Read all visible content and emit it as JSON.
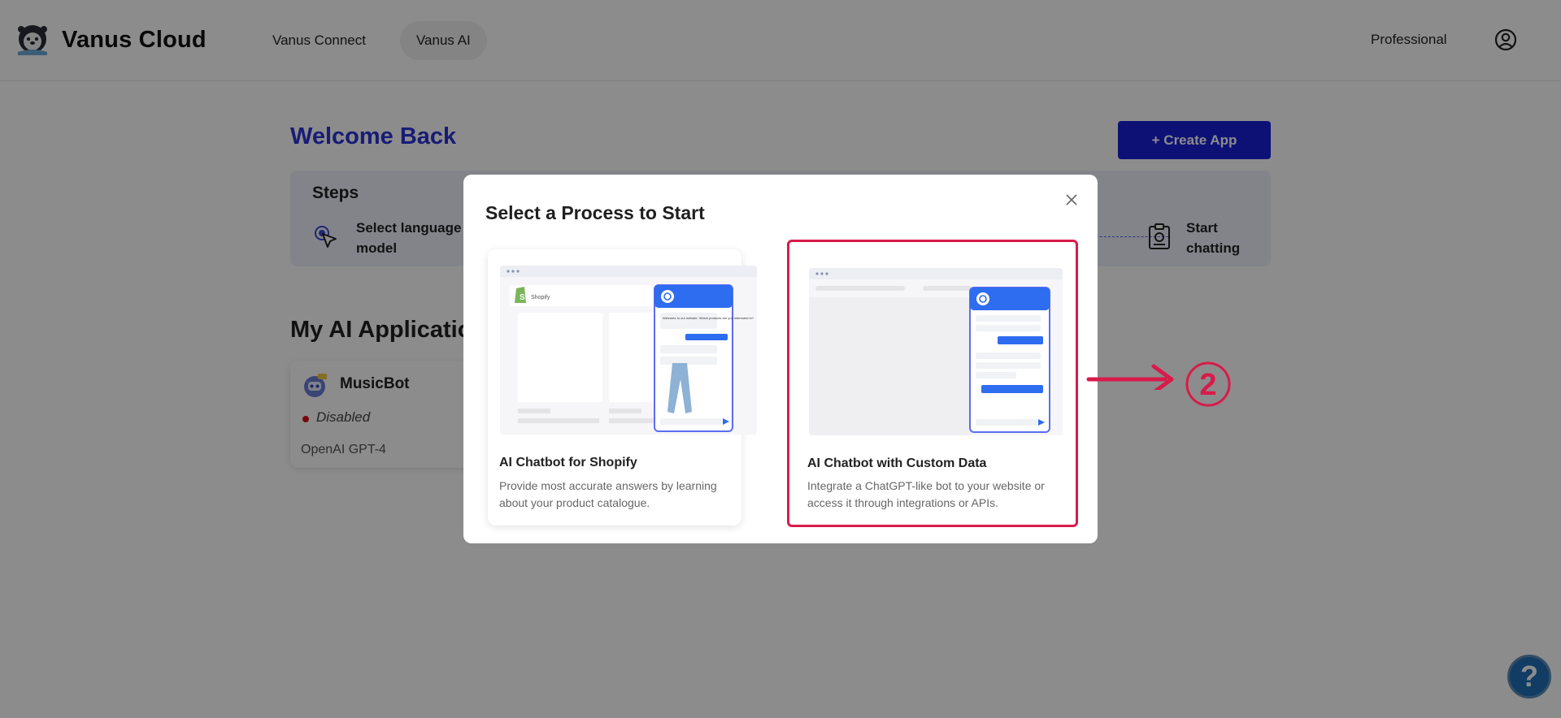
{
  "header": {
    "brand": "Vanus Cloud",
    "nav": [
      "Vanus Connect",
      "Vanus AI"
    ],
    "active_nav": "Vanus AI",
    "plan": "Professional"
  },
  "main": {
    "welcome": "Welcome Back",
    "create_button": "+ Create App",
    "steps": {
      "title": "Steps",
      "first": "Select language model",
      "last": "Start chatting"
    },
    "apps_title": "My AI Applications",
    "app_card": {
      "name": "MusicBot",
      "status": "Disabled",
      "model": "OpenAI GPT-4"
    }
  },
  "modal": {
    "title": "Select a Process to Start",
    "options": [
      {
        "title": "AI Chatbot for Shopify",
        "description": "Provide most accurate answers by learning about your product catalogue.",
        "preview_brand": "Shopify",
        "preview_chat_text": "Welcome to our website. Which products are you interested in?"
      },
      {
        "title": "AI Chatbot with Custom Data",
        "description": "Integrate a ChatGPT-like bot to your website or access it through integrations or APIs."
      }
    ]
  },
  "annotation": {
    "number": "2",
    "color": "#d81b4a"
  },
  "colors": {
    "accent": "#1820d8",
    "title_blue": "#2c34d8",
    "highlight": "#d81b4a"
  }
}
